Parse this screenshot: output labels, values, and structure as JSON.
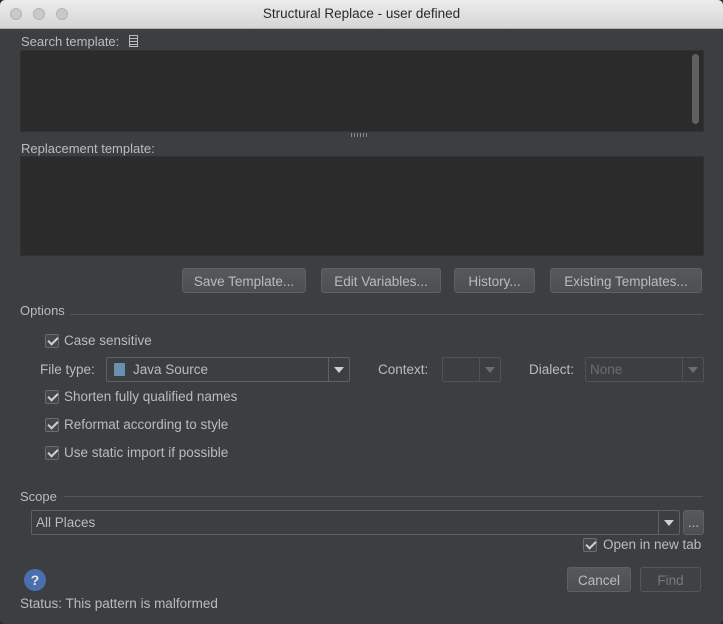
{
  "window": {
    "title": "Structural Replace - user defined"
  },
  "search": {
    "label": "Search template:"
  },
  "replacement": {
    "label": "Replacement template:"
  },
  "buttons": {
    "save_template": "Save Template...",
    "edit_variables": "Edit Variables...",
    "history": "History...",
    "existing_templates": "Existing Templates...",
    "cancel": "Cancel",
    "find": "Find"
  },
  "options": {
    "section_label": "Options",
    "case_sensitive": {
      "label": "Case sensitive",
      "checked": true
    },
    "file_type": {
      "label": "File type:",
      "value": "Java Source",
      "icon": "java-file-icon"
    },
    "context": {
      "label": "Context:",
      "value": ""
    },
    "dialect": {
      "label": "Dialect:",
      "value": "None"
    },
    "shorten_names": {
      "label": "Shorten fully qualified names",
      "checked": true
    },
    "reformat": {
      "label": "Reformat according to style",
      "checked": true
    },
    "static_import": {
      "label": "Use static import if possible",
      "checked": true
    }
  },
  "scope": {
    "section_label": "Scope",
    "value": "All Places",
    "browse_label": "...",
    "open_in_new_tab": {
      "label": "Open in new tab",
      "checked": true
    }
  },
  "status": {
    "text": "Status: This pattern is malformed"
  },
  "colors": {
    "background": "#3c3f41",
    "editor": "#2b2b2b",
    "help": "#4b6eaf"
  }
}
